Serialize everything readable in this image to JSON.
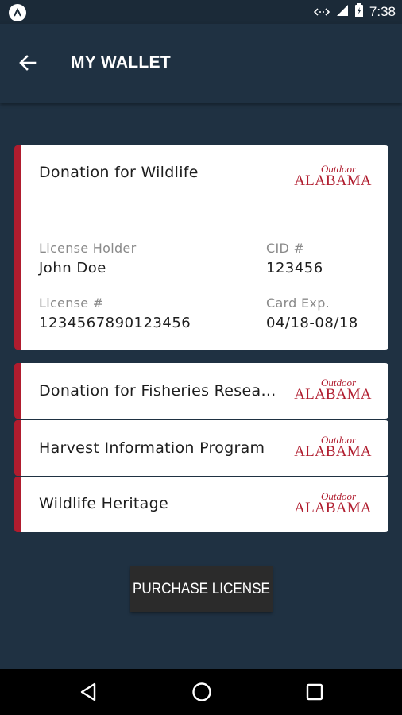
{
  "status_bar": {
    "time": "7:38",
    "icons": [
      "android-app-icon",
      "data-sync-icon",
      "signal-icon",
      "battery-icon"
    ]
  },
  "app_bar": {
    "title": "MY WALLET",
    "back_icon": "arrow-left-icon"
  },
  "licenses": {
    "expanded": {
      "title": "Donation for Wildlife",
      "logo": {
        "line1": "Outdoor",
        "line2": "ALABAMA"
      },
      "holder_label": "License Holder",
      "holder_value": "John Doe",
      "cid_label": "CID #",
      "cid_value": "123456",
      "license_label": "License #",
      "license_value": "1234567890123456",
      "exp_label": "Card Exp.",
      "exp_value": "04/18-08/18"
    },
    "collapsed": [
      {
        "title": "Donation for Fisheries Research",
        "logo": {
          "line1": "Outdoor",
          "line2": "ALABAMA"
        }
      },
      {
        "title": "Harvest Information Program",
        "logo": {
          "line1": "Outdoor",
          "line2": "ALABAMA"
        }
      },
      {
        "title": "Wildlife Heritage",
        "logo": {
          "line1": "Outdoor",
          "line2": "ALABAMA"
        }
      }
    ]
  },
  "purchase_button": {
    "label": "PURCHASE LICENSE"
  },
  "nav_bar": {
    "icons": [
      "back-triangle-icon",
      "home-circle-icon",
      "recents-square-icon"
    ]
  },
  "colors": {
    "background": "#1f3142",
    "accent": "#b01c2e",
    "card": "#ffffff",
    "button": "#2b2b2b"
  }
}
